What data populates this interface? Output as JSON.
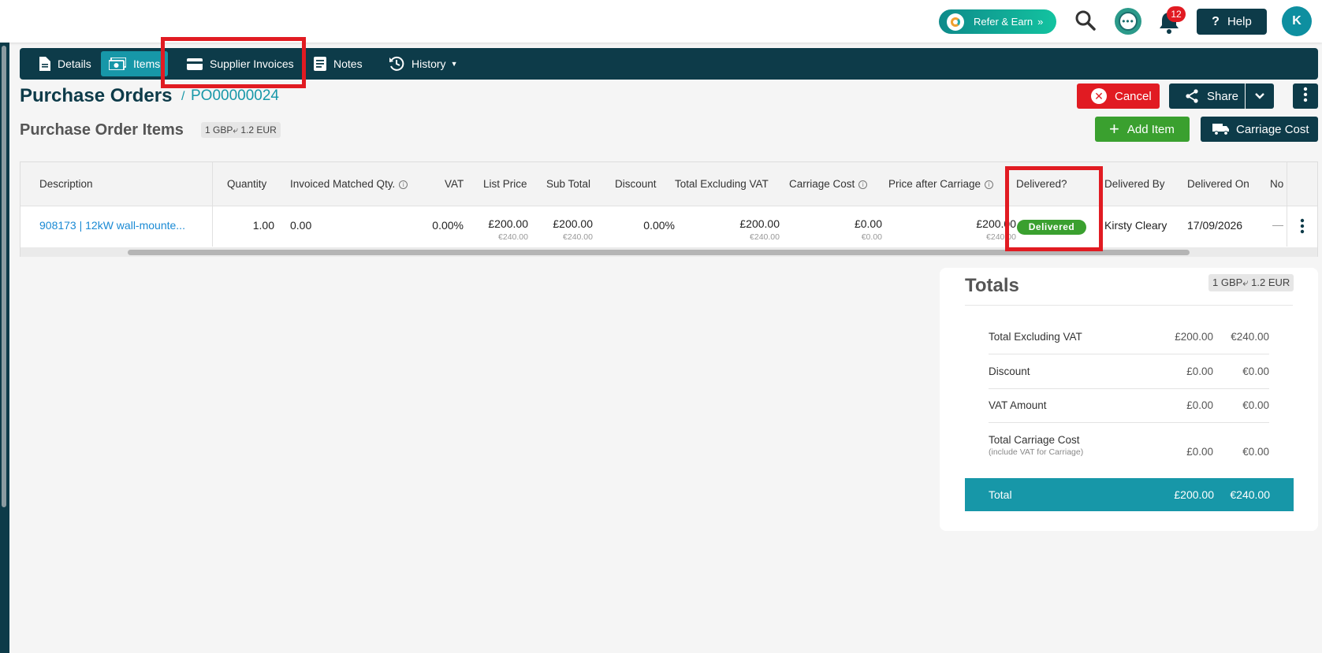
{
  "topbar": {
    "refer_label": "Refer & Earn",
    "notification_count": "12",
    "help_label": "Help",
    "avatar_initial": "K"
  },
  "tabs": [
    {
      "label": "Details",
      "icon": "document-icon",
      "active": false
    },
    {
      "label": "Items",
      "icon": "money-icon",
      "active": true
    },
    {
      "label": "Supplier Invoices",
      "icon": "credit-card-icon",
      "active": false
    },
    {
      "label": "Notes",
      "icon": "notes-icon",
      "active": false
    },
    {
      "label": "History",
      "icon": "history-icon",
      "active": false
    }
  ],
  "page": {
    "title": "Purchase Orders",
    "crumb_sep": "/",
    "po_number": "PO00000024",
    "section_title": "Purchase Order Items",
    "exchange_rate": "1 GBP⤶ 1.2 EUR"
  },
  "actions": {
    "cancel_label": "Cancel",
    "share_label": "Share",
    "add_item_label": "Add Item",
    "carriage_cost_label": "Carriage Cost"
  },
  "table": {
    "headers": {
      "description": "Description",
      "quantity": "Quantity",
      "invoiced_matched": "Invoiced Matched Qty.",
      "vat": "VAT",
      "list_price": "List Price",
      "sub_total": "Sub Total",
      "discount": "Discount",
      "total_excl_vat": "Total Excluding VAT",
      "carriage_cost": "Carriage Cost",
      "price_after_carriage": "Price after Carriage",
      "delivered": "Delivered?",
      "delivered_by": "Delivered By",
      "delivered_on": "Delivered On",
      "notes_trunc": "No"
    },
    "row": {
      "description": "908173 | 12kW wall-mounte...",
      "quantity": "1.00",
      "invoiced_matched": "0.00",
      "vat": "0.00%",
      "list_price": "£200.00",
      "list_price_eur": "€240.00",
      "sub_total": "£200.00",
      "sub_total_eur": "€240.00",
      "discount": "0.00%",
      "total_excl_vat": "£200.00",
      "total_excl_vat_eur": "€240.00",
      "carriage_cost": "£0.00",
      "carriage_cost_eur": "€0.00",
      "price_after_carriage": "£200.00",
      "price_after_carriage_eur": "€240.00",
      "delivered_status": "Delivered",
      "delivered_by": "Kirsty Cleary",
      "delivered_on": "17/09/2026",
      "notes": "—"
    }
  },
  "totals": {
    "title": "Totals",
    "exchange_rate": "1 GBP⤶ 1.2 EUR",
    "rows": [
      {
        "label": "Total Excluding VAT",
        "gbp": "£200.00",
        "eur": "€240.00"
      },
      {
        "label": "Discount",
        "gbp": "£0.00",
        "eur": "€0.00"
      },
      {
        "label": "VAT Amount",
        "gbp": "£0.00",
        "eur": "€0.00"
      },
      {
        "label": "Total Carriage Cost",
        "note": "(include VAT for Carriage)",
        "gbp": "£0.00",
        "eur": "€0.00"
      }
    ],
    "total": {
      "label": "Total",
      "gbp": "£200.00",
      "eur": "€240.00"
    }
  },
  "colors": {
    "navy": "#0d3b49",
    "teal": "#1797a8",
    "red": "#e11b22",
    "green": "#3aa02f"
  }
}
